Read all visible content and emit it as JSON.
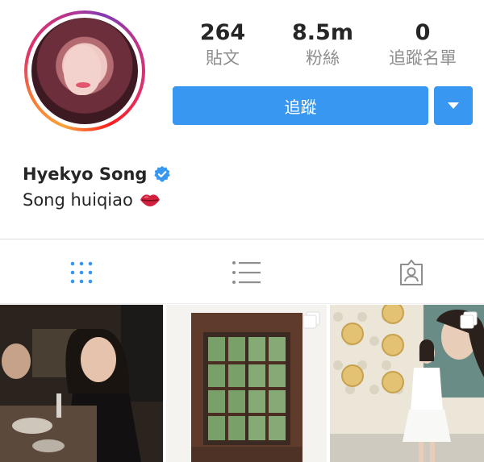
{
  "profile": {
    "username": "Hyekyo Song",
    "bio": "Song huiqiao",
    "verified": true,
    "bio_emoji_icon": "kiss-mark-icon"
  },
  "stats": {
    "posts_count": "264",
    "posts_label": "貼文",
    "followers_count": "8.5m",
    "followers_label": "粉絲",
    "following_count": "0",
    "following_label": "追蹤名單"
  },
  "actions": {
    "follow_label": "追蹤",
    "dropdown_icon": "caret-down-icon"
  },
  "tabs": [
    {
      "icon": "grid-icon",
      "active": true
    },
    {
      "icon": "list-icon",
      "active": false
    },
    {
      "icon": "tagged-icon",
      "active": false
    }
  ],
  "colors": {
    "accent": "#3897f0",
    "text": "#262626",
    "muted": "#8e8e8e",
    "divider": "#dbdbdb"
  }
}
